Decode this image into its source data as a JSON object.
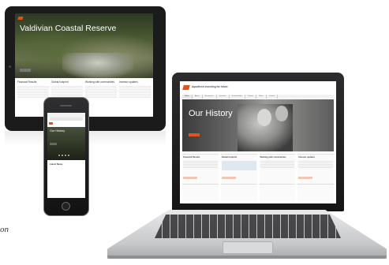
{
  "laptop": {
    "brand": "Aquafresh  investing for future",
    "utility": "",
    "nav": [
      "Home",
      "About",
      "Businesses",
      "Investors",
      "Sustainability",
      "Careers",
      "News",
      "Contact"
    ],
    "hero_title": "Our History",
    "hero_subtitle": "",
    "panels": [
      {
        "title": "Financial Results"
      },
      {
        "title": "Global footprint"
      },
      {
        "title": "Working with communities"
      },
      {
        "title": "Investor updates"
      }
    ],
    "row2": [
      "",
      "",
      "",
      ""
    ]
  },
  "tablet": {
    "brand": "",
    "hero_title": "Valdivian Coastal Reserve",
    "hero_text": "",
    "columns": [
      {
        "title": "Financial Results"
      },
      {
        "title": "Global footprint"
      },
      {
        "title": "Working with communities"
      },
      {
        "title": "Investor updates"
      }
    ]
  },
  "phone": {
    "url": "",
    "brand": "",
    "hero_title": "Our History",
    "hero_text": "",
    "section_title": "Latest News",
    "section_items": [
      "",
      ""
    ]
  },
  "caption": "on",
  "colors": {
    "accent": "#e0541c",
    "device_dark": "#1b1b1c",
    "aluminium": "#c7c8ca"
  }
}
